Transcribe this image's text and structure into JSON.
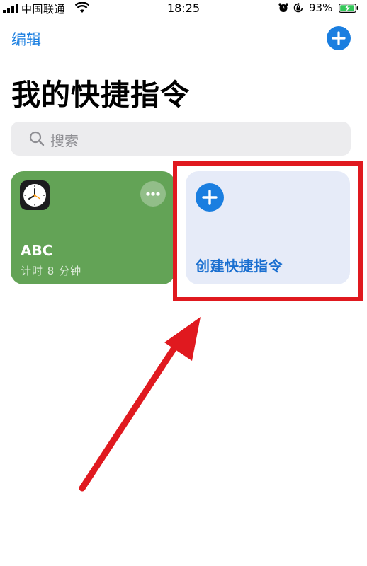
{
  "status_bar": {
    "carrier": "中国联通",
    "time": "18:25",
    "battery_percent": "93%",
    "battery_level": 0.93,
    "icons": [
      "signal-icon",
      "wifi-icon",
      "alarm-icon",
      "orientation-lock-icon",
      "battery-charging-icon"
    ]
  },
  "header": {
    "edit_label": "编辑",
    "add_icon": "plus-circle-icon",
    "title": "我的快捷指令"
  },
  "search": {
    "placeholder": "搜索",
    "icon": "search-icon"
  },
  "shortcuts": [
    {
      "title": "ABC",
      "subtitle": "计时 8 分钟",
      "color": "#63a356",
      "icon": "clock-icon",
      "more_icon": "ellipsis-icon"
    }
  ],
  "create_card": {
    "label": "创建快捷指令",
    "icon": "plus-circle-icon",
    "color": "#e6ebf8"
  },
  "colors": {
    "accent": "#1a7ee0",
    "annotation": "#e0191f"
  }
}
